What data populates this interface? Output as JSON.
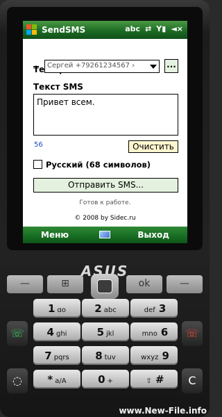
{
  "titlebar": {
    "app_title": "SendSMS",
    "status_abc": "abc",
    "status_sync": "⇄",
    "status_signal": "Y▮",
    "status_volume": "◄×"
  },
  "form": {
    "phone_label": "Телефон",
    "plus_sign": "+",
    "contact_value": "Сергей +79261234567 ›",
    "contacts_button": "...",
    "sms_label": "Текст SMS",
    "message_text": "Привет всем.",
    "char_counter": "56",
    "clear_button": "Очистить",
    "russian_checkbox_label": "Русский (68 символов)",
    "russian_checked": false,
    "send_button": "Отправить SMS...",
    "status": "Готов к работе.",
    "copyright": "© 2008 by Sidec.ru"
  },
  "softkeys": {
    "left": "Меню",
    "right": "Выход"
  },
  "device": {
    "brand": "ASUS",
    "watermark": "www.New-File.info"
  },
  "keypad": [
    {
      "digit": "1",
      "letters": "ɑo"
    },
    {
      "digit": "2",
      "letters": "abc"
    },
    {
      "digit": "3",
      "letters": "def"
    },
    {
      "digit": "4",
      "letters": "ghi"
    },
    {
      "digit": "5",
      "letters": "jkl"
    },
    {
      "digit": "6",
      "letters": "mno"
    },
    {
      "digit": "7",
      "letters": "pqrs"
    },
    {
      "digit": "8",
      "letters": "tuv"
    },
    {
      "digit": "9",
      "letters": "wxyz"
    },
    {
      "digit": "*",
      "letters": "a/A"
    },
    {
      "digit": "0",
      "letters": "+"
    },
    {
      "digit": "#",
      "letters": "⇧"
    }
  ],
  "colors": {
    "titlebar_green": "#1d6b24",
    "softbar_green": "#166b22",
    "clear_button_bg": "#fdf6cf",
    "send_button_bg": "#e4f1de"
  }
}
